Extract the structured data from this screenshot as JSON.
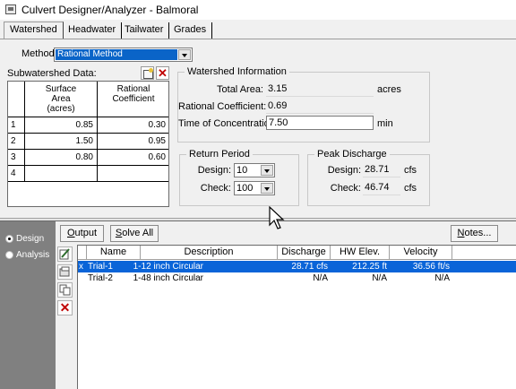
{
  "window": {
    "title": "Culvert Designer/Analyzer - Balmoral"
  },
  "tabs": [
    "Watershed",
    "Headwater",
    "Tailwater",
    "Grades"
  ],
  "method": {
    "label": "Method:",
    "value": "Rational Method"
  },
  "subwatershed": {
    "label": "Subwatershed Data:",
    "headers": [
      "Surface Area (acres)",
      "Rational Coefficient"
    ],
    "header_lines": [
      [
        "Surface",
        "Area",
        "(acres)"
      ],
      [
        "Rational",
        "Coefficient"
      ]
    ],
    "rows": [
      {
        "index": "1",
        "area": "0.85",
        "coeff": "0.30"
      },
      {
        "index": "2",
        "area": "1.50",
        "coeff": "0.95"
      },
      {
        "index": "3",
        "area": "0.80",
        "coeff": "0.60"
      },
      {
        "index": "4",
        "area": "",
        "coeff": ""
      }
    ]
  },
  "watershed_info": {
    "title": "Watershed Information",
    "total_area_label": "Total Area:",
    "total_area_value": "3.15",
    "total_area_unit": "acres",
    "rational_coeff_label": "Rational Coefficient:",
    "rational_coeff_value": "0.69",
    "toc_label": "Time of Concentration:",
    "toc_value": "7.50",
    "toc_unit": "min"
  },
  "return_period": {
    "title": "Return Period",
    "design_label": "Design:",
    "design_value": "10",
    "check_label": "Check:",
    "check_value": "100"
  },
  "peak_discharge": {
    "title": "Peak Discharge",
    "design_label": "Design:",
    "design_value": "28.71",
    "check_label": "Check:",
    "check_value": "46.74",
    "unit": "cfs"
  },
  "nav": {
    "design": "Design",
    "analysis": "Analysis"
  },
  "buttons": {
    "output_first": "O",
    "output_rest": "utput",
    "solve_first": "S",
    "solve_rest": "olve All",
    "notes_first": "N",
    "notes_rest": "otes..."
  },
  "results": {
    "headers": [
      "Name",
      "Description",
      "Discharge",
      "HW Elev.",
      "Velocity"
    ],
    "rows": [
      {
        "marker": "x",
        "name": "Trial-1",
        "description": "1-12 inch Circular",
        "discharge": "28.71 cfs",
        "hw_elev": "212.25 ft",
        "velocity": "36.56 ft/s"
      },
      {
        "marker": "",
        "name": "Trial-2",
        "description": "1-48 inch Circular",
        "discharge": "N/A",
        "hw_elev": "N/A",
        "velocity": "N/A"
      }
    ]
  },
  "colors": {
    "selection": "#0a64d8",
    "nav_background": "#808080",
    "delete": "#c00000"
  }
}
